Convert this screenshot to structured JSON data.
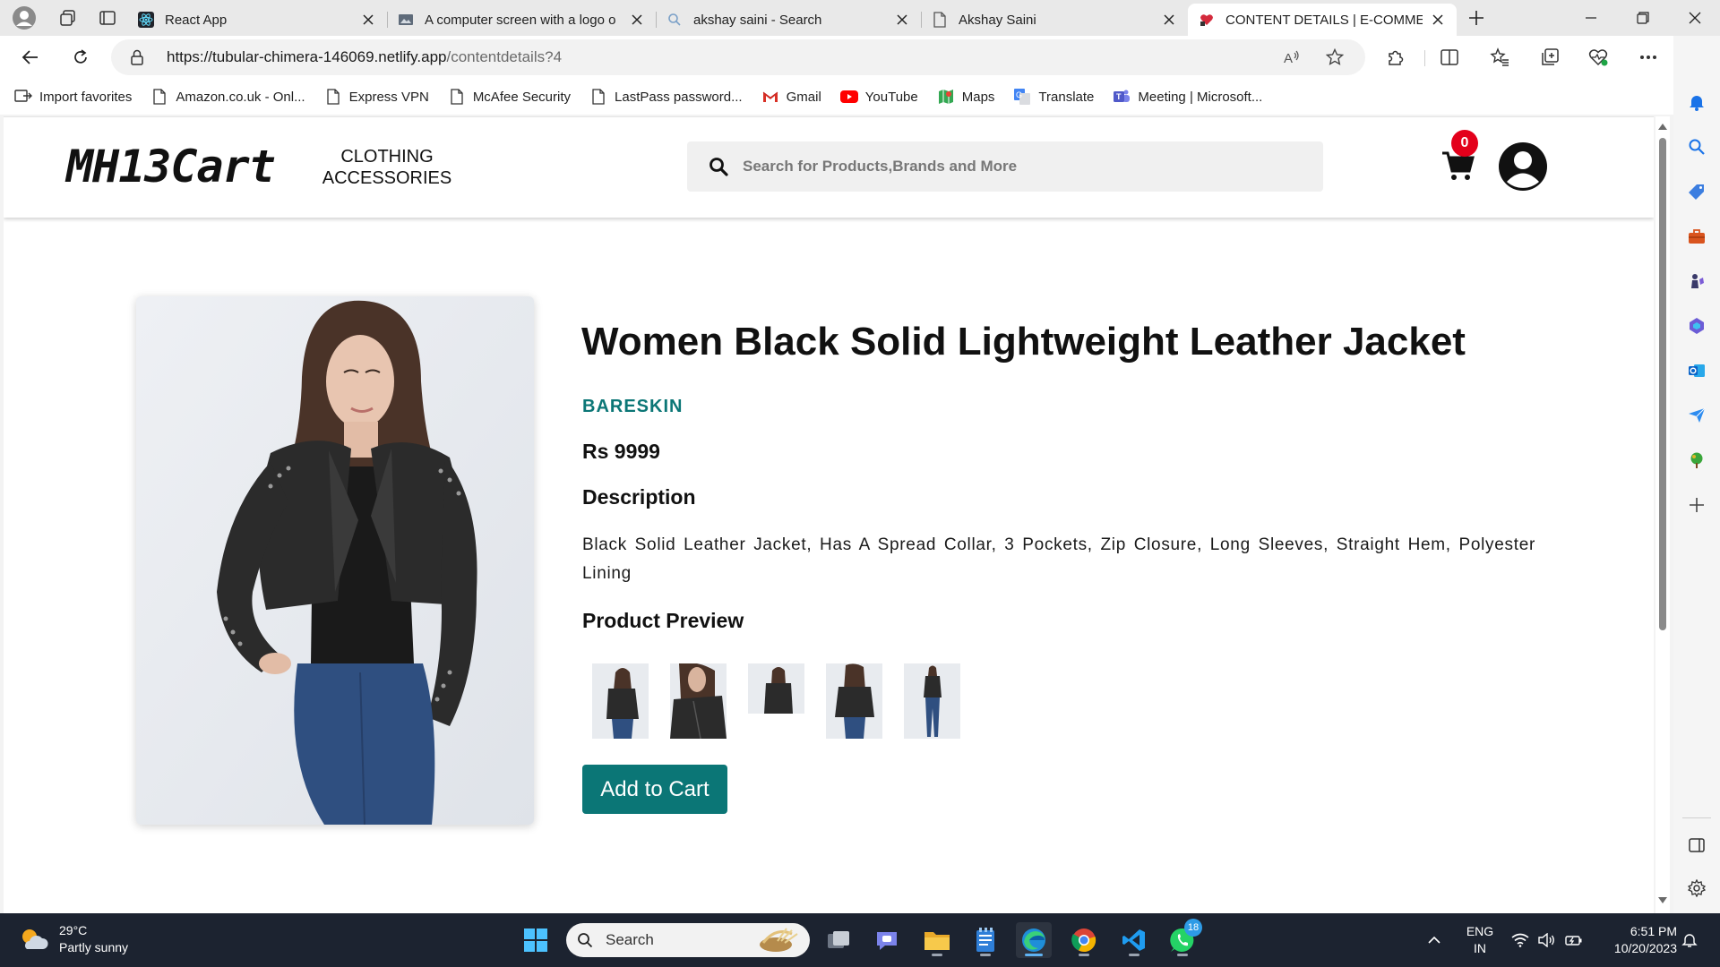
{
  "browser": {
    "tabs": [
      {
        "title": "React App",
        "icon": "react-icon"
      },
      {
        "title": "A computer screen with a logo o",
        "icon": "image-icon"
      },
      {
        "title": "akshay saini - Search",
        "icon": "search-icon"
      },
      {
        "title": "Akshay Saini",
        "icon": "page-icon"
      },
      {
        "title": "CONTENT DETAILS | E-COMMERC",
        "icon": "heart-favicon"
      }
    ],
    "url_host": "https://tubular-chimera-146069.netlify.app",
    "url_path": "/contentdetails?4",
    "favorites": [
      {
        "label": "Import favorites",
        "icon": "import-icon"
      },
      {
        "label": "Amazon.co.uk - Onl...",
        "icon": "page-icon"
      },
      {
        "label": "Express VPN",
        "icon": "page-icon"
      },
      {
        "label": "McAfee Security",
        "icon": "page-icon"
      },
      {
        "label": "LastPass password...",
        "icon": "page-icon"
      },
      {
        "label": "Gmail",
        "icon": "gmail-icon"
      },
      {
        "label": "YouTube",
        "icon": "youtube-icon"
      },
      {
        "label": "Maps",
        "icon": "maps-icon"
      },
      {
        "label": "Translate",
        "icon": "translate-icon"
      },
      {
        "label": "Meeting | Microsoft...",
        "icon": "teams-icon"
      }
    ]
  },
  "site": {
    "logo": "MH13Cart",
    "nav": {
      "line1": "CLOTHING",
      "line2": "ACCESSORIES"
    },
    "search_placeholder": "Search for Products,Brands and More",
    "cart_count": "0"
  },
  "product": {
    "title": "Women Black Solid Lightweight Leather Jacket",
    "brand": "BARESKIN",
    "price": "Rs 9999",
    "description_heading": "Description",
    "description": "Black Solid Leather Jacket, Has A Spread Collar, 3 Pockets, Zip Closure, Long Sleeves, Straight Hem, Polyester Lining",
    "preview_heading": "Product Preview",
    "add_to_cart": "Add to Cart"
  },
  "taskbar": {
    "temperature": "29°C",
    "weather": "Partly sunny",
    "search_label": "Search",
    "lang1": "ENG",
    "lang2": "IN",
    "time": "6:51 PM",
    "date": "10/20/2023",
    "whatsapp_badge": "18"
  },
  "colors": {
    "brand_teal": "#0b7676",
    "cart_badge": "#e3001b",
    "taskbar": "#1c2330"
  }
}
